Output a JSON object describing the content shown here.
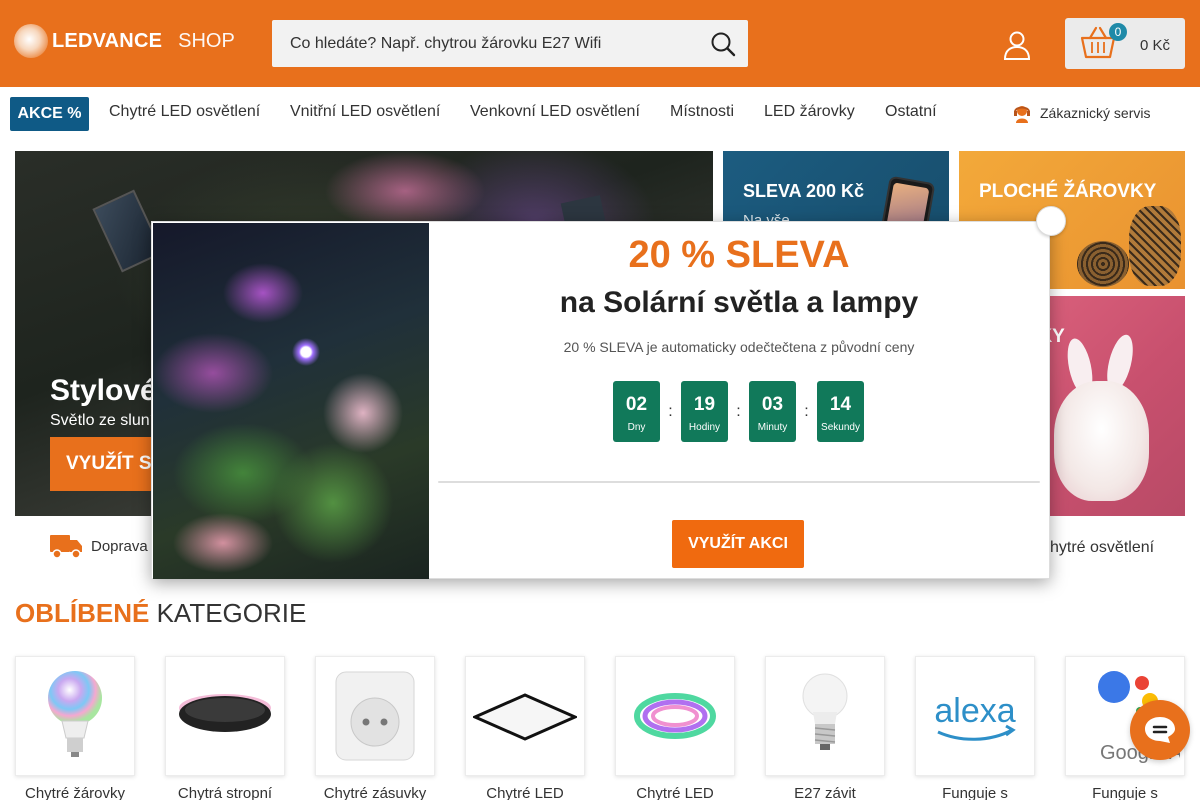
{
  "header": {
    "brand": "LEDVANCE",
    "shop": "SHOP",
    "search_placeholder": "Co hledáte? Např. chytrou žárovku E27 Wifi",
    "cart_count": "0",
    "cart_total": "0 Kč"
  },
  "nav": {
    "akce": "AKCE %",
    "items": [
      "Chytré LED osvětlení",
      "Vnitřní LED osvětlení",
      "Venkovní LED osvětlení",
      "Místnosti",
      "LED žárovky",
      "Ostatní"
    ],
    "service": "Zákaznický servis"
  },
  "hero": {
    "title": "Stylové",
    "subtitle": "Světlo ze sluní",
    "button": "VYUŽÍT S"
  },
  "banners": {
    "a_title": "SLEVA 200 Kč",
    "a_sub": "Na vše",
    "b_title": "PLOCHÉ ŽÁROVKY",
    "c_title": "A DÁRKY"
  },
  "benefits": {
    "shipping": "Doprava",
    "smart": "chytré osvětlení"
  },
  "categories": {
    "heading_highlight": "OBLÍBENÉ",
    "heading_rest": "KATEGORIE",
    "items": [
      {
        "label": "Chytré žárovky",
        "icon": "smart-bulb"
      },
      {
        "label": "Chytrá stropní",
        "icon": "ceiling-light"
      },
      {
        "label": "Chytré zásuvky",
        "icon": "smart-plug"
      },
      {
        "label": "Chytré LED",
        "icon": "led-panel"
      },
      {
        "label": "Chytré LED",
        "icon": "led-strip"
      },
      {
        "label": "E27 závit",
        "icon": "e27-bulb"
      },
      {
        "label": "Funguje s",
        "icon": "alexa-logo"
      },
      {
        "label": "Funguje s",
        "icon": "google-assistant-logo"
      }
    ],
    "alexa_text": "alexa",
    "google_text": "Google Assistant"
  },
  "modal": {
    "percent": "20 % SLEVA",
    "title": "na Solární světla a lampy",
    "note": "20 % SLEVA je automaticky odečtečtena z původní ceny",
    "countdown": [
      {
        "value": "02",
        "label": "Dny"
      },
      {
        "value": "19",
        "label": "Hodiny"
      },
      {
        "value": "03",
        "label": "Minuty"
      },
      {
        "value": "14",
        "label": "Sekundy"
      }
    ],
    "button": "VYUŽÍT AKCI"
  },
  "colors": {
    "brand_orange": "#e8701c",
    "nav_blue": "#0f5a86",
    "countdown_green": "#11795a",
    "cart_badge": "#1f8aa8"
  }
}
